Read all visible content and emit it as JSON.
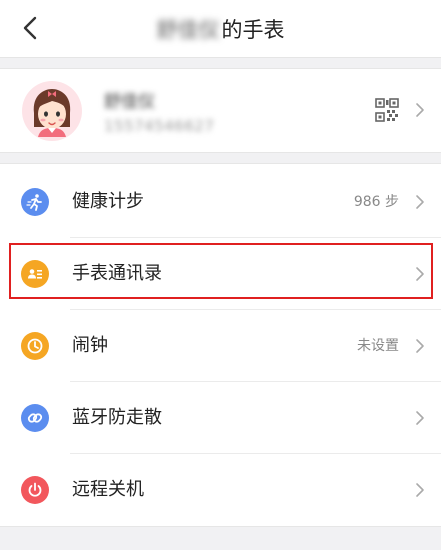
{
  "header": {
    "owner_name": "舒佳仪",
    "title_suffix": "的手表"
  },
  "profile": {
    "name": "舒佳仪",
    "phone": "15574546627"
  },
  "menu": {
    "items": [
      {
        "label": "健康计步",
        "value": "986 步",
        "icon": "running-person-icon",
        "color": "#5b8def"
      },
      {
        "label": "手表通讯录",
        "value": "",
        "icon": "contact-card-icon",
        "color": "#f5a623"
      },
      {
        "label": "闹钟",
        "value": "未设置",
        "icon": "clock-icon",
        "color": "#f5a623"
      },
      {
        "label": "蓝牙防走散",
        "value": "",
        "icon": "link-icon",
        "color": "#5b8def"
      },
      {
        "label": "远程关机",
        "value": "",
        "icon": "power-icon",
        "color": "#f2575c"
      }
    ]
  },
  "colors": {
    "highlight": "#e02020",
    "background": "#f1f1f3"
  }
}
